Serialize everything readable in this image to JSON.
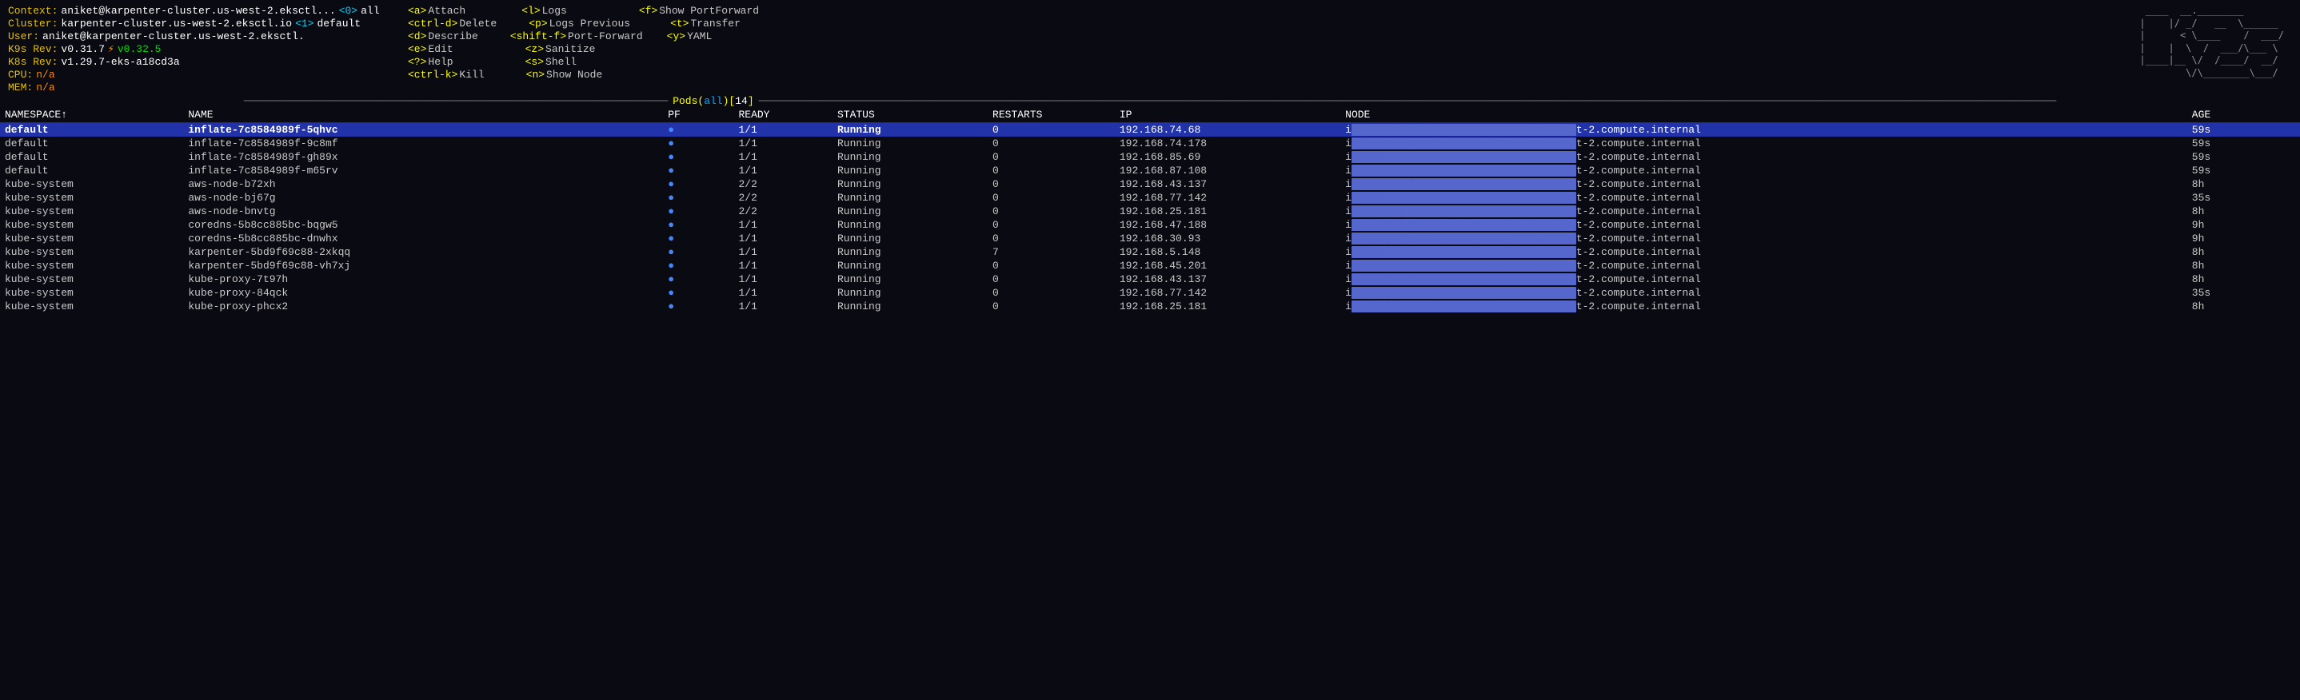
{
  "header": {
    "context_label": "Context:",
    "context_value": "aniket@karpenter-cluster.us-west-2.eksctl...",
    "cluster_label": "Cluster:",
    "cluster_value": "karpenter-cluster.us-west-2.eksctl.io",
    "user_label": "User:",
    "user_value": "aniket@karpenter-cluster.us-west-2.eksctl.",
    "k9s_rev_label": "K9s Rev:",
    "k9s_rev_value": "v0.31.7",
    "k9s_rev_new": "v0.32.5",
    "k8s_rev_label": "K8s Rev:",
    "k8s_rev_value": "v1.29.7-eks-a18cd3a",
    "cpu_label": "CPU:",
    "cpu_value": "n/a",
    "mem_label": "MEM:",
    "mem_value": "n/a",
    "namespace_0": "<0>",
    "namespace_0_val": "all",
    "namespace_1": "<1>",
    "namespace_1_val": "default"
  },
  "keybinds": {
    "col1": [
      {
        "key": "<a>",
        "action": "Attach"
      },
      {
        "key": "<ctrl-d>",
        "action": "Delete"
      },
      {
        "key": "<d>",
        "action": "Describe"
      },
      {
        "key": "<e>",
        "action": "Edit"
      },
      {
        "key": "<?>",
        "action": "Help"
      },
      {
        "key": "<ctrl-k>",
        "action": "Kill"
      }
    ],
    "col2": [
      {
        "key": "<l>",
        "action": "Logs"
      },
      {
        "key": "<p>",
        "action": "Logs Previous"
      },
      {
        "key": "<shift-f>",
        "action": "Port-Forward"
      },
      {
        "key": "<z>",
        "action": "Sanitize"
      },
      {
        "key": "<s>",
        "action": "Shell"
      },
      {
        "key": "<n>",
        "action": "Show Node"
      }
    ],
    "col3": [
      {
        "key": "<f>",
        "action": "Show PortForward"
      },
      {
        "key": "<t>",
        "action": "Transfer"
      },
      {
        "key": "<y>",
        "action": "YAML"
      }
    ]
  },
  "section": {
    "title": "Pods(all)[14]"
  },
  "table": {
    "columns": [
      "NAMESPACE↑",
      "NAME",
      "PF",
      "READY",
      "STATUS",
      "RESTARTS",
      "IP",
      "NODE",
      "AGE"
    ],
    "rows": [
      {
        "namespace": "default",
        "name": "inflate-7c8584989f-5qhvc",
        "pf": "●",
        "ready": "1/1",
        "status": "Running",
        "restarts": "0",
        "ip": "192.168.74.68",
        "node": "i▓▓▓▓▓▓▓▓▓▓▓▓▓▓▓▓▓▓▓▓▓▓▓t-2.compute.internal",
        "age": "59s",
        "selected": true
      },
      {
        "namespace": "default",
        "name": "inflate-7c8584989f-9c8mf",
        "pf": "●",
        "ready": "1/1",
        "status": "Running",
        "restarts": "0",
        "ip": "192.168.74.178",
        "node": "i▓▓▓▓▓▓▓▓▓▓▓▓▓▓▓▓▓▓▓▓▓▓▓t-2.compute.internal",
        "age": "59s",
        "selected": false
      },
      {
        "namespace": "default",
        "name": "inflate-7c8584989f-gh89x",
        "pf": "●",
        "ready": "1/1",
        "status": "Running",
        "restarts": "0",
        "ip": "192.168.85.69",
        "node": "i▓▓▓▓▓▓▓▓▓▓▓▓▓▓▓▓▓▓▓▓▓▓▓t-2.compute.internal",
        "age": "59s",
        "selected": false
      },
      {
        "namespace": "default",
        "name": "inflate-7c8584989f-m65rv",
        "pf": "●",
        "ready": "1/1",
        "status": "Running",
        "restarts": "0",
        "ip": "192.168.87.108",
        "node": "i▓▓▓▓▓▓▓▓▓▓▓▓▓▓▓▓▓▓▓▓▓▓▓t-2.compute.internal",
        "age": "59s",
        "selected": false
      },
      {
        "namespace": "kube-system",
        "name": "aws-node-b72xh",
        "pf": "●",
        "ready": "2/2",
        "status": "Running",
        "restarts": "0",
        "ip": "192.168.43.137",
        "node": "i▓▓▓▓▓▓▓▓▓▓▓▓▓▓▓▓▓▓▓▓▓▓▓t-2.compute.internal",
        "age": "8h",
        "selected": false
      },
      {
        "namespace": "kube-system",
        "name": "aws-node-bj67g",
        "pf": "●",
        "ready": "2/2",
        "status": "Running",
        "restarts": "0",
        "ip": "192.168.77.142",
        "node": "i▓▓▓▓▓▓▓▓▓▓▓▓▓▓▓▓▓▓▓▓▓▓▓t-2.compute.internal",
        "age": "35s",
        "selected": false
      },
      {
        "namespace": "kube-system",
        "name": "aws-node-bnvtg",
        "pf": "●",
        "ready": "2/2",
        "status": "Running",
        "restarts": "0",
        "ip": "192.168.25.181",
        "node": "i▓▓▓▓▓▓▓▓▓▓▓▓▓▓▓▓▓▓▓▓▓▓▓t-2.compute.internal",
        "age": "8h",
        "selected": false
      },
      {
        "namespace": "kube-system",
        "name": "coredns-5b8cc885bc-bqgw5",
        "pf": "●",
        "ready": "1/1",
        "status": "Running",
        "restarts": "0",
        "ip": "192.168.47.188",
        "node": "i▓▓▓▓▓▓▓▓▓▓▓▓▓▓▓▓▓▓▓▓▓▓▓t-2.compute.internal",
        "age": "9h",
        "selected": false
      },
      {
        "namespace": "kube-system",
        "name": "coredns-5b8cc885bc-dnwhx",
        "pf": "●",
        "ready": "1/1",
        "status": "Running",
        "restarts": "0",
        "ip": "192.168.30.93",
        "node": "i▓▓▓▓▓▓▓▓▓▓▓▓▓▓▓▓▓▓▓▓▓▓▓t-2.compute.internal",
        "age": "9h",
        "selected": false
      },
      {
        "namespace": "kube-system",
        "name": "karpenter-5bd9f69c88-2xkqq",
        "pf": "●",
        "ready": "1/1",
        "status": "Running",
        "restarts": "7",
        "ip": "192.168.5.148",
        "node": "i▓▓▓▓▓▓▓▓▓▓▓▓▓▓▓▓▓▓▓▓▓▓▓t-2.compute.internal",
        "age": "8h",
        "selected": false
      },
      {
        "namespace": "kube-system",
        "name": "karpenter-5bd9f69c88-vh7xj",
        "pf": "●",
        "ready": "1/1",
        "status": "Running",
        "restarts": "0",
        "ip": "192.168.45.201",
        "node": "i▓▓▓▓▓▓▓▓▓▓▓▓▓▓▓▓▓▓▓▓▓▓▓t-2.compute.internal",
        "age": "8h",
        "selected": false
      },
      {
        "namespace": "kube-system",
        "name": "kube-proxy-7t97h",
        "pf": "●",
        "ready": "1/1",
        "status": "Running",
        "restarts": "0",
        "ip": "192.168.43.137",
        "node": "i▓▓▓▓▓▓▓▓▓▓▓▓▓▓▓▓▓▓▓▓▓▓▓t-2.compute.internal",
        "age": "8h",
        "selected": false
      },
      {
        "namespace": "kube-system",
        "name": "kube-proxy-84qck",
        "pf": "●",
        "ready": "1/1",
        "status": "Running",
        "restarts": "0",
        "ip": "192.168.77.142",
        "node": "i▓▓▓▓▓▓▓▓▓▓▓▓▓▓▓▓▓▓▓▓▓▓▓t-2.compute.internal",
        "age": "35s",
        "selected": false
      },
      {
        "namespace": "kube-system",
        "name": "kube-proxy-phcx2",
        "pf": "●",
        "ready": "1/1",
        "status": "Running",
        "restarts": "0",
        "ip": "192.168.25.181",
        "node": "i▓▓▓▓▓▓▓▓▓▓▓▓▓▓▓▓▓▓▓▓▓▓▓t-2.compute.internal",
        "age": "8h",
        "selected": false
      }
    ]
  }
}
